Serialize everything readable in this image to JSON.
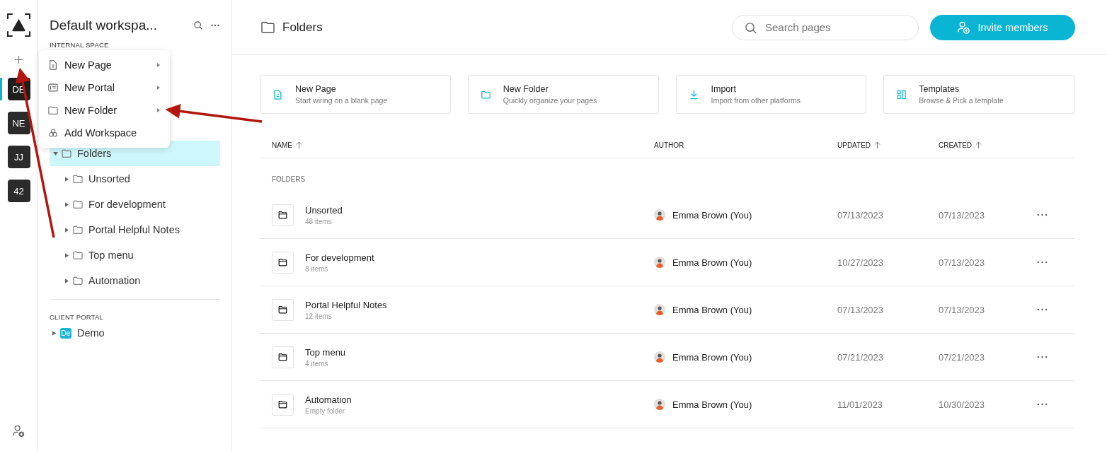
{
  "rail": {
    "workspaces": [
      {
        "label": "DE",
        "selected": true
      },
      {
        "label": "NE",
        "selected": false
      },
      {
        "label": "JJ",
        "selected": false
      },
      {
        "label": "42",
        "selected": false
      }
    ]
  },
  "sidebar": {
    "title": "Default workspa...",
    "section": "INTERNAL SPACE",
    "tree": [
      {
        "label": "Folders",
        "selected": true,
        "expanded": true,
        "children": [
          {
            "label": "Unsorted",
            "selected": false,
            "expanded": false
          },
          {
            "label": "For development",
            "selected": false,
            "expanded": false
          },
          {
            "label": "Portal Helpful Notes",
            "selected": false,
            "expanded": false
          },
          {
            "label": "Top menu",
            "selected": false,
            "expanded": false
          },
          {
            "label": "Automation",
            "selected": false,
            "expanded": false
          }
        ]
      }
    ],
    "client_section": "CLIENT PORTAL",
    "portals": [
      {
        "badge": "De",
        "label": "Demo",
        "expanded": false
      }
    ]
  },
  "menu": [
    {
      "kind": "page",
      "label": "New Page",
      "submenu": true
    },
    {
      "kind": "portal",
      "label": "New Portal",
      "submenu": true
    },
    {
      "kind": "folder",
      "label": "New Folder",
      "submenu": true
    },
    {
      "kind": "workspace",
      "label": "Add Workspace",
      "submenu": false
    }
  ],
  "header": {
    "title": "Folders",
    "search": {
      "placeholder": "Search pages"
    },
    "invite": "Invite members"
  },
  "actions": [
    {
      "kind": "page",
      "title": "New Page",
      "subtitle": "Start wiring on a blank page"
    },
    {
      "kind": "folder",
      "title": "New Folder",
      "subtitle": "Quickly organize your pages"
    },
    {
      "kind": "import",
      "title": "Import",
      "subtitle": "Import from other platforms"
    },
    {
      "kind": "templates",
      "title": "Templates",
      "subtitle": "Browse & Pick a template"
    }
  ],
  "table": {
    "columns": [
      {
        "label": "NAME",
        "sorted": true
      },
      {
        "label": "AUTHOR",
        "sorted": false
      },
      {
        "label": "UPDATED",
        "sorted": true
      },
      {
        "label": "CREATED",
        "sorted": true
      }
    ],
    "section": "FOLDERS",
    "rows": [
      {
        "name": "Unsorted",
        "meta": "48 items",
        "author": "Emma Brown (You)",
        "updated": "07/13/2023",
        "created": "07/13/2023"
      },
      {
        "name": "For development",
        "meta": "8 items",
        "author": "Emma Brown (You)",
        "updated": "10/27/2023",
        "created": "07/13/2023"
      },
      {
        "name": "Portal Helpful Notes",
        "meta": "12 items",
        "author": "Emma Brown (You)",
        "updated": "07/13/2023",
        "created": "07/13/2023"
      },
      {
        "name": "Top menu",
        "meta": "4 items",
        "author": "Emma Brown (You)",
        "updated": "07/21/2023",
        "created": "07/21/2023"
      },
      {
        "name": "Automation",
        "meta": "Empty folder",
        "author": "Emma Brown (You)",
        "updated": "11/01/2023",
        "created": "10/30/2023"
      }
    ]
  }
}
